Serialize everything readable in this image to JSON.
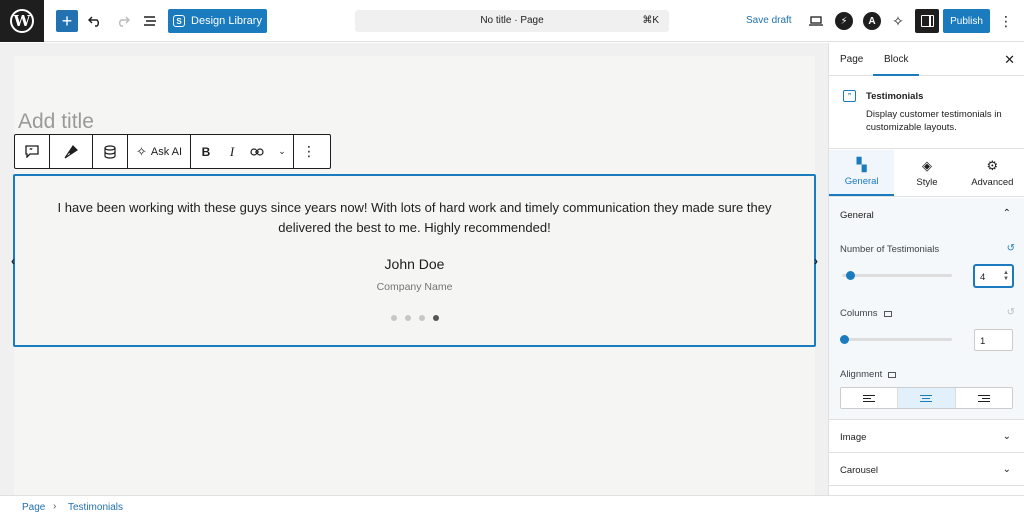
{
  "header": {
    "add_label": "+",
    "design_library_label": "Design Library",
    "doc_title": "No title · Page",
    "shortcut": "⌘K",
    "save_draft_label": "Save draft",
    "publish_label": "Publish"
  },
  "canvas": {
    "title_placeholder": "Add title",
    "toolbar": {
      "ask_ai_label": "Ask AI",
      "bold": "B",
      "italic": "I"
    },
    "testimonial": {
      "quote": "I have been working with these guys since years now! With lots of hard work and timely communication they made sure they delivered the best to me. Highly recommended!",
      "author": "John Doe",
      "company": "Company Name",
      "slides": 4,
      "active_slide": 4
    }
  },
  "sidebar": {
    "tabs": [
      "Page",
      "Block"
    ],
    "active_tab": "Block",
    "block": {
      "name": "Testimonials",
      "description": "Display customer testimonials in customizable layouts."
    },
    "subtabs": [
      "General",
      "Style",
      "Advanced"
    ],
    "general": {
      "heading": "General",
      "num_testimonials_label": "Number of Testimonials",
      "num_testimonials_value": "4",
      "columns_label": "Columns",
      "columns_value": "1",
      "alignment_label": "Alignment",
      "alignment_selected": "center"
    },
    "collapsed_panels": [
      "Image",
      "Carousel"
    ]
  },
  "footer": {
    "breadcrumb": [
      "Page",
      "Testimonials"
    ]
  },
  "colors": {
    "accent": "#1a7bbf",
    "dark": "#1e1e1e"
  }
}
